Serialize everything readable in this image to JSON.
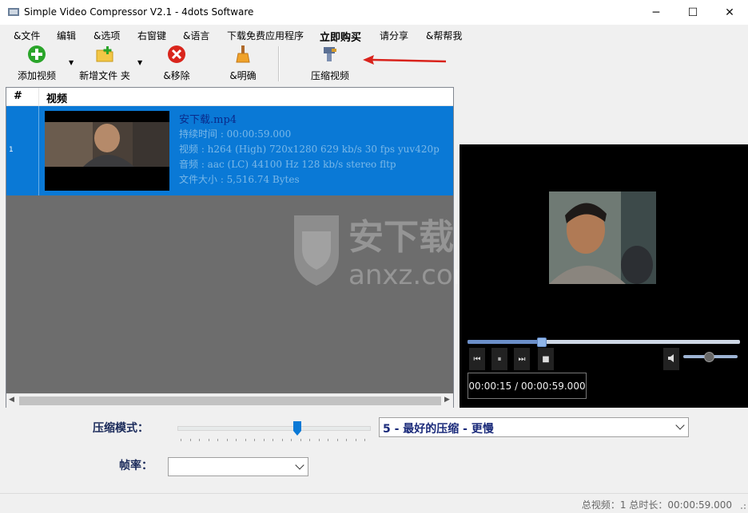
{
  "window": {
    "title": "Simple Video Compressor V2.1 - 4dots Software",
    "controls": {
      "minimize": "─",
      "maximize": "☐",
      "close": "✕"
    }
  },
  "menu": [
    {
      "label": "&文件"
    },
    {
      "label": "编辑"
    },
    {
      "label": "&选项"
    },
    {
      "label": "右窗键"
    },
    {
      "label": "&语言"
    },
    {
      "label": "下载免费应用程序"
    },
    {
      "label": "立即购买"
    },
    {
      "label": "请分享"
    },
    {
      "label": "&帮帮我"
    }
  ],
  "toolbar": {
    "add_video": "添加视频",
    "add_folder": "新增文件 夹",
    "remove": "&移除",
    "clear": "&明确",
    "compress": "压缩视频",
    "dropdown_glyph": "▼"
  },
  "list": {
    "col_num": "#",
    "col_video": "视频",
    "rows": [
      {
        "num": "1",
        "file": "安下载.mp4",
        "duration": "持续时间 : 00:00:59.000",
        "video": "视频 : h264 (High) 720x1280 629 kb/s 30 fps yuv420p",
        "audio": "音频 : aac (LC) 44100 Hz 128 kb/s stereo fltp",
        "size": "文件大小 : 5,516.74 Bytes"
      }
    ],
    "scroll_left": "◀",
    "scroll_right": "▶"
  },
  "player": {
    "time": "00:00:15 / 00:00:59.000",
    "progress": 0.27,
    "volume": 0.45,
    "prev_glyph": "⏮",
    "pause_glyph": "⏸",
    "next_glyph": "⏭",
    "stop_glyph": "■"
  },
  "settings": {
    "compression_label": "压缩模式：",
    "compression_value": "5 - 最好的压缩 - 更慢",
    "compression_level": 5,
    "compression_max": 10,
    "fps_label": "帧率：",
    "fps_value": ""
  },
  "status": {
    "text": "总视频：1   总时长：00:00:59.000"
  },
  "watermark": {
    "line1": "安下载",
    "line2": "anxz.com"
  },
  "colors": {
    "selection": "#0a79d6",
    "list_bg": "#6d6d6d",
    "arrow": "#d9231c"
  }
}
